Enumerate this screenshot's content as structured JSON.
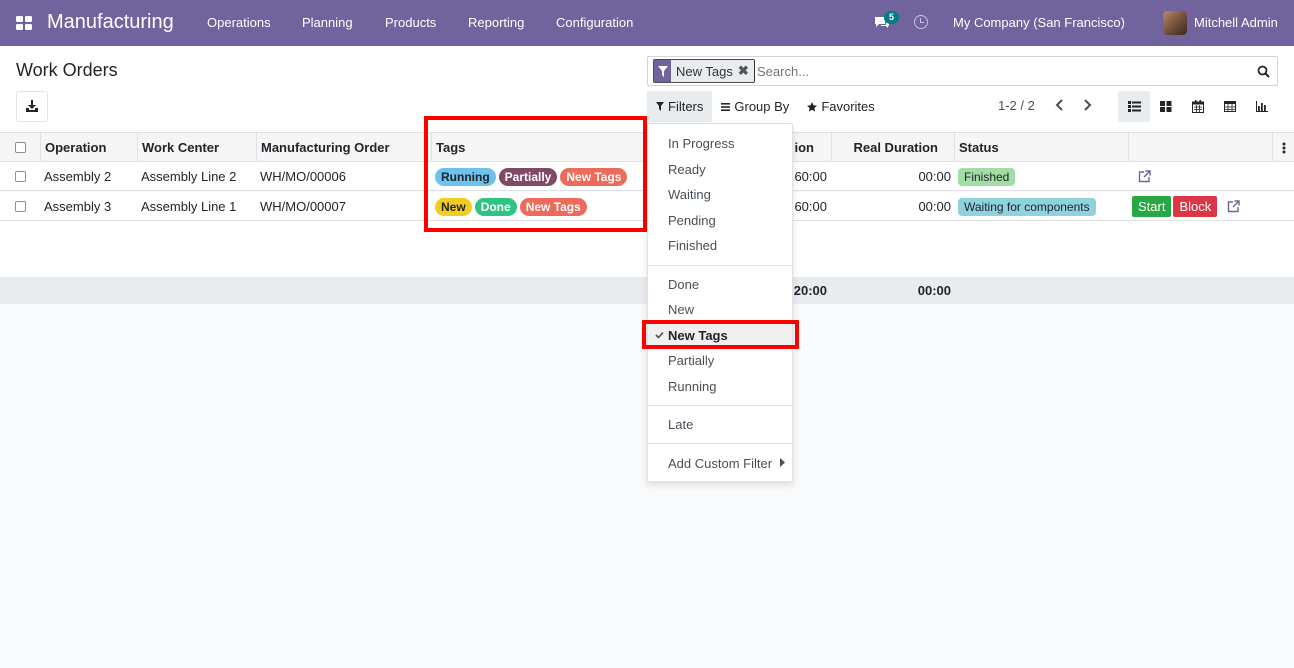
{
  "navbar": {
    "app_name": "Manufacturing",
    "menu": [
      "Operations",
      "Planning",
      "Products",
      "Reporting",
      "Configuration"
    ],
    "messages_count": "5",
    "company": "My Company (San Francisco)",
    "user": "Mitchell Admin"
  },
  "page": {
    "title": "Work Orders"
  },
  "search": {
    "facet_label": "New Tags",
    "placeholder": "Search..."
  },
  "filter_bar": {
    "filters": "Filters",
    "group_by": "Group By",
    "favorites": "Favorites"
  },
  "pager": {
    "value": "1-2 / 2"
  },
  "table": {
    "columns": [
      "Operation",
      "Work Center",
      "Manufacturing Order",
      "Tags",
      "ion",
      "Real Duration",
      "Status"
    ],
    "rows": [
      {
        "operation": "Assembly 2",
        "work_center": "Assembly Line 2",
        "mo": "WH/MO/00006",
        "tags": [
          "Running",
          "Partially",
          "New Tags"
        ],
        "expected": "60:00",
        "real": "00:00",
        "status": "Finished"
      },
      {
        "operation": "Assembly 3",
        "work_center": "Assembly Line 1",
        "mo": "WH/MO/00007",
        "tags": [
          "New",
          "Done",
          "New Tags"
        ],
        "expected": "60:00",
        "real": "00:00",
        "status": "Waiting for components",
        "start": "Start",
        "block": "Block"
      }
    ],
    "totals": {
      "expected": "20:00",
      "real": "00:00"
    }
  },
  "filters_dropdown": {
    "group1": [
      "In Progress",
      "Ready",
      "Waiting",
      "Pending",
      "Finished"
    ],
    "group2": [
      "Done",
      "New",
      "New Tags",
      "Partially",
      "Running"
    ],
    "selected": "New Tags",
    "group3": [
      "Late"
    ],
    "custom": "Add Custom Filter"
  },
  "colors": {
    "navbar": "#71639e",
    "tag_running": "#6cc1ed",
    "tag_partially": "#814968",
    "tag_new_tags": "#ee6a5a",
    "tag_new": "#f3cc22",
    "tag_done": "#30c381",
    "status_finished": "#a3dda6",
    "status_waiting": "#8fd2dd",
    "highlight": "#ff0000"
  }
}
